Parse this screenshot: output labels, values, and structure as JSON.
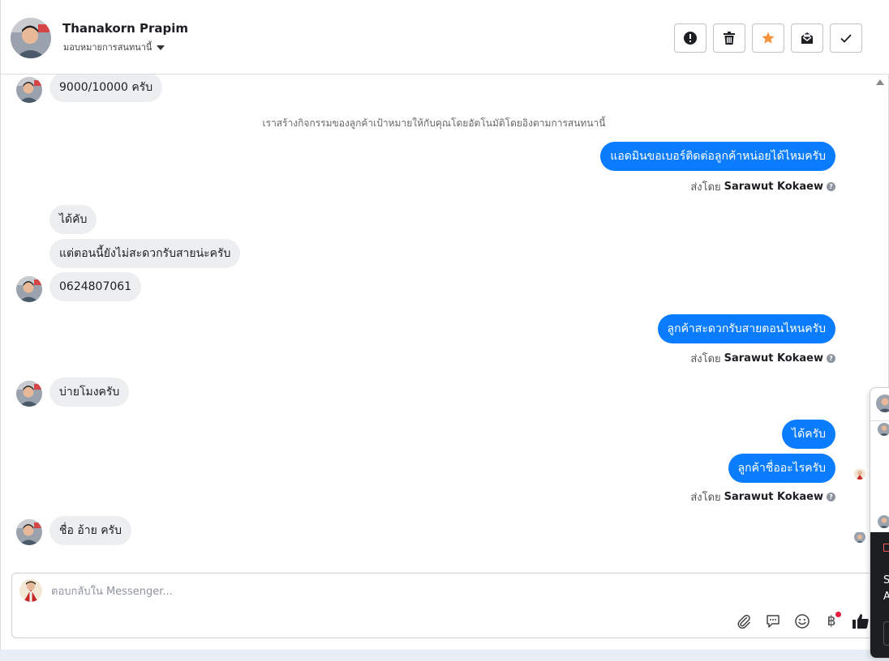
{
  "header": {
    "name": "Thanakorn Prapim",
    "assign_label": "มอบหมายการสนทนานี้",
    "actions": [
      {
        "name": "spam",
        "icon": "alert-circle-icon"
      },
      {
        "name": "delete",
        "icon": "trash-icon"
      },
      {
        "name": "star",
        "icon": "star-icon",
        "color": "#f7923b"
      },
      {
        "name": "mark-unread",
        "icon": "envelope-icon"
      },
      {
        "name": "done",
        "icon": "check-icon"
      }
    ]
  },
  "messages": {
    "m1": "9000/10000 ครับ",
    "system_note": "เราสร้างกิจกรรมของลูกค้าเป้าหมายให้กับคุณโดยอัตโนมัติโดยอิงตามการสนทนานี้",
    "m2": "แอดมินขอเบอร์ติดต่อลูกค้าหน่อยได้ไหมครับ",
    "m3": "ได้คับ",
    "m4": "แต่ตอนนี้ยังไม่สะดวกรับสายน่ะครับ",
    "m5": "0624807061",
    "m6": "ลูกค้าสะดวกรับสายตอนไหนครับ",
    "m7": "บ่ายโมงครับ",
    "m8": "ได้ครับ",
    "m9": "ลูกค้าชื่ออะไรครับ",
    "m10": "ชื่อ อ้าย ครับ"
  },
  "sent_by": {
    "prefix": "ส่งโดย",
    "agent": "Sarawut Kokaew"
  },
  "composer": {
    "placeholder": "ตอบกลับใน Messenger...",
    "tools": [
      "paperclip-icon",
      "saved-reply-icon",
      "emoji-icon",
      "baht-payment-icon",
      "thumbs-up-icon"
    ],
    "baht_symbol": "฿"
  },
  "side_popup": {
    "line1": "S",
    "line2": "A"
  },
  "colors": {
    "outgoing_bubble": "#0a7cff",
    "incoming_bubble": "#eceef0",
    "star": "#f7923b",
    "badge": "#e41e3f"
  }
}
